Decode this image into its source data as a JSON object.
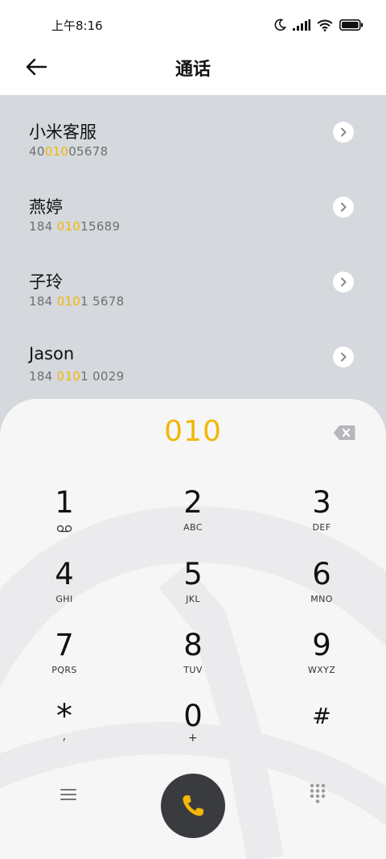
{
  "status_bar": {
    "time": "上午8:16"
  },
  "header": {
    "title": "通话"
  },
  "contacts": [
    {
      "name": "小米客服",
      "number_pre": "40",
      "number_match": "010",
      "number_post": "05678"
    },
    {
      "name": "燕婷",
      "number_pre": "184 ",
      "number_match": "010",
      "number_post": "15689"
    },
    {
      "name": "子玲",
      "number_pre": "184 ",
      "number_match": "010",
      "number_post": "1 5678"
    },
    {
      "name": "Jason",
      "number_pre": "184 ",
      "number_match": "010",
      "number_post": "1 0029"
    }
  ],
  "dialpad": {
    "input": "010",
    "keys": [
      {
        "digit": "1",
        "letters": ""
      },
      {
        "digit": "2",
        "letters": "ABC"
      },
      {
        "digit": "3",
        "letters": "DEF"
      },
      {
        "digit": "4",
        "letters": "GHI"
      },
      {
        "digit": "5",
        "letters": "JKL"
      },
      {
        "digit": "6",
        "letters": "MNO"
      },
      {
        "digit": "7",
        "letters": "PQRS"
      },
      {
        "digit": "8",
        "letters": "TUV"
      },
      {
        "digit": "9",
        "letters": "WXYZ"
      },
      {
        "digit": "*",
        "letters": ","
      },
      {
        "digit": "0",
        "letters": "+"
      },
      {
        "digit": "#",
        "letters": ""
      }
    ]
  },
  "colors": {
    "accent": "#f2b705",
    "call_button": "#3a3b3f",
    "list_bg": "#d5d8dc"
  },
  "icons": [
    "moon-icon",
    "signal-icon",
    "wifi-icon",
    "battery-icon",
    "back-arrow-icon",
    "chevron-right-icon",
    "backspace-icon",
    "voicemail-icon",
    "menu-icon",
    "phone-icon",
    "keypad-icon"
  ]
}
